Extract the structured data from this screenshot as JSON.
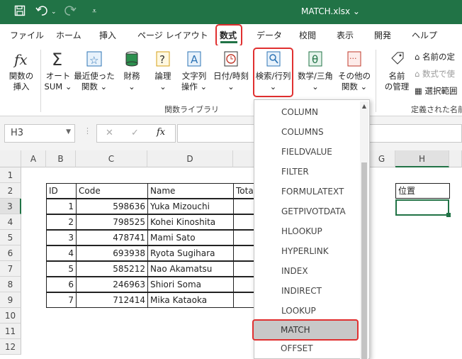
{
  "title": "MATCH.xlsx",
  "title_caret": "⌄",
  "quick_access": {
    "save_icon": "save-icon",
    "undo_icon": "undo-icon",
    "redo_icon": "redo-icon",
    "customize_icon": "customize-icon"
  },
  "tabs": [
    "ファイル",
    "ホーム",
    "挿入",
    "ページ レイアウト",
    "数式",
    "データ",
    "校閲",
    "表示",
    "開発",
    "ヘルプ"
  ],
  "active_tab": "数式",
  "ribbon": {
    "buttons": [
      {
        "label1": "関数の",
        "label2": "挿入"
      },
      {
        "label1": "オート",
        "label2": "SUM ⌄"
      },
      {
        "label1": "最近使った",
        "label2": "関数 ⌄"
      },
      {
        "label1": "財務",
        "label2": "⌄"
      },
      {
        "label1": "論理",
        "label2": "⌄"
      },
      {
        "label1": "文字列",
        "label2": "操作 ⌄"
      },
      {
        "label1": "日付/時刻",
        "label2": "⌄"
      },
      {
        "label1": "検索/行列",
        "label2": "⌄"
      },
      {
        "label1": "数学/三角",
        "label2": "⌄"
      },
      {
        "label1": "その他の",
        "label2": "関数 ⌄"
      },
      {
        "label1": "名前",
        "label2": "の管理"
      }
    ],
    "group_label": "関数ライブラリ",
    "side_items": [
      "名前の定",
      "数式で使",
      "選択範囲"
    ],
    "side_group_label": "定義された名前"
  },
  "formula_bar": {
    "name_box": "H3",
    "cancel": "✕",
    "enter": "✓",
    "fx": "fx"
  },
  "columns": [
    "A",
    "B",
    "C",
    "D",
    "",
    "G",
    "H"
  ],
  "rows": [
    "1",
    "2",
    "3",
    "4",
    "5",
    "6",
    "7",
    "8",
    "9",
    "10",
    "11",
    "12"
  ],
  "table": {
    "headers": [
      "ID",
      "Code",
      "Name",
      "Tota"
    ],
    "rows": [
      {
        "id": "1",
        "code": "598636",
        "name": "Yuka Mizouchi"
      },
      {
        "id": "2",
        "code": "798525",
        "name": "Kohei Kinoshita"
      },
      {
        "id": "3",
        "code": "478741",
        "name": "Mami Sato"
      },
      {
        "id": "4",
        "code": "693938",
        "name": "Ryota Sugihara"
      },
      {
        "id": "5",
        "code": "585212",
        "name": "Nao Akamatsu"
      },
      {
        "id": "6",
        "code": "246963",
        "name": "Shiori Soma"
      },
      {
        "id": "7",
        "code": "712414",
        "name": "Mika Kataoka"
      }
    ]
  },
  "h2": "位置",
  "dropdown_items": [
    "COLUMN",
    "COLUMNS",
    "FIELDVALUE",
    "FILTER",
    "FORMULATEXT",
    "GETPIVOTDATA",
    "HLOOKUP",
    "HYPERLINK",
    "INDEX",
    "INDIRECT",
    "LOOKUP",
    "MATCH",
    "OFFSET"
  ],
  "dropdown_scroll_up": "▲",
  "colors": {
    "excel_green": "#217346",
    "highlight_red": "#e03030"
  }
}
